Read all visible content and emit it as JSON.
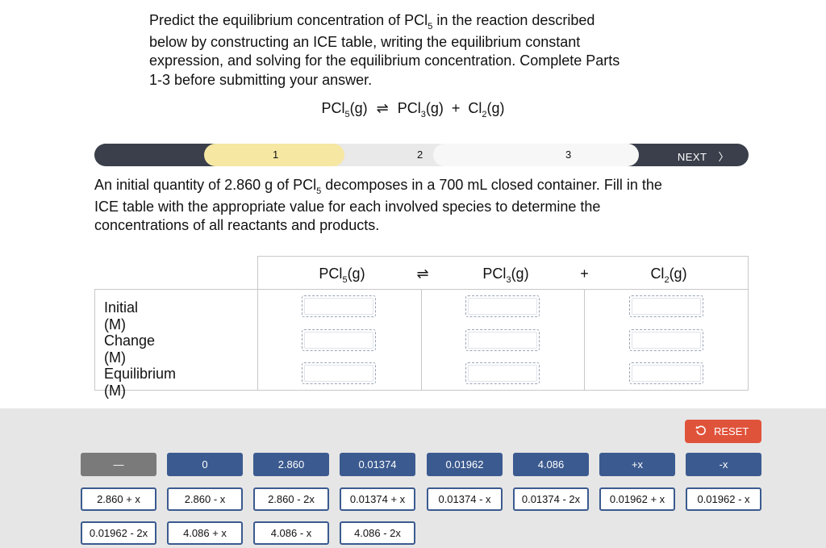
{
  "prompt": {
    "line1": "Predict the equilibrium concentration of PCl",
    "line1_sub": "5",
    "line1_rest": " in the reaction described",
    "line2": "below by constructing an ICE table, writing the equilibrium constant",
    "line3": "expression, and solving for the equilibrium concentration. Complete Parts",
    "line4": "1-3 before submitting your answer."
  },
  "reaction": {
    "r1": "PCl",
    "r1_sub": "5",
    "r1_state": "(g)",
    "arrow": "⇌",
    "p1": "PCl",
    "p1_sub": "3",
    "p1_state": "(g)",
    "plus": "+",
    "p2": "Cl",
    "p2_sub": "2",
    "p2_state": "(g)"
  },
  "progress": {
    "steps": [
      "1",
      "2",
      "3"
    ],
    "current_step": 1,
    "next_label": "NEXT",
    "next_chevron": "〉"
  },
  "instruction": {
    "line1a": "An initial quantity of 2.860 g of PCl",
    "line1_sub": "5",
    "line1b": " decomposes in a 700 mL closed container. Fill in the",
    "line2": "ICE table with the appropriate value for each involved species to determine the",
    "line3": "concentrations of all reactants and products."
  },
  "ice_table": {
    "rows": [
      "Initial (M)",
      "Change (M)",
      "Equilibrium (M)"
    ],
    "col1": {
      "formula": "PCl",
      "sub": "5",
      "state": "(g)"
    },
    "arrow": "⇌",
    "col2": {
      "formula": "PCl",
      "sub": "3",
      "state": "(g)"
    },
    "plus": "+",
    "col3": {
      "formula": "Cl",
      "sub": "2",
      "state": "(g)"
    }
  },
  "tray": {
    "reset_label": "RESET",
    "tiles_row1": [
      "—",
      "0",
      "2.860",
      "0.01374",
      "0.01962",
      "4.086",
      "+x",
      "-x"
    ],
    "tiles_row2": [
      "2.860 + x",
      "2.860 - x",
      "2.860 - 2x",
      "0.01374 + x",
      "0.01374 - x",
      "0.01374 - 2x",
      "0.01962 + x",
      "0.01962 - x"
    ],
    "tiles_row3": [
      "0.01962 - 2x",
      "4.086 + x",
      "4.086 - x",
      "4.086 - 2x"
    ]
  },
  "colors": {
    "tile_blue": "#3b5a8f",
    "reset_red": "#e0533b",
    "progress_current": "#f6e7a3",
    "progress_dark": "#3a3f4b"
  }
}
